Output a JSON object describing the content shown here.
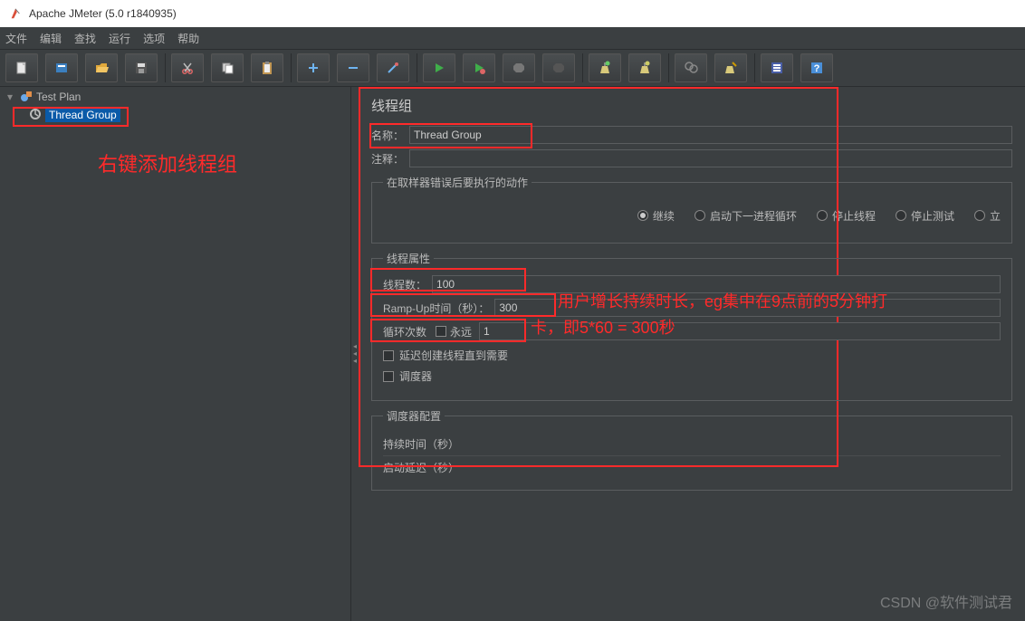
{
  "window": {
    "title": "Apache JMeter (5.0 r1840935)"
  },
  "menu": {
    "file": "文件",
    "edit": "编辑",
    "search": "查找",
    "run": "运行",
    "options": "选项",
    "help": "帮助"
  },
  "toolbar_icons": [
    "new-file-icon",
    "open-templates-icon",
    "open-icon",
    "save-icon",
    "sep",
    "cut-icon",
    "copy-icon",
    "paste-icon",
    "sep",
    "expand-icon",
    "collapse-icon",
    "toggle-icon",
    "sep",
    "start-icon",
    "start-no-timers-icon",
    "stop-icon",
    "shutdown-icon",
    "sep",
    "clear-icon",
    "clear-all-icon",
    "sep",
    "search-icon",
    "reset-search-icon",
    "sep",
    "function-helper-icon",
    "help-icon"
  ],
  "tree": {
    "testplan": "Test Plan",
    "threadgroup": "Thread Group"
  },
  "annotations": {
    "tree_note": "右键添加线程组",
    "rampup_note_line1": "用户增长持续时长，eg集中在9点前的5分钟打",
    "rampup_note_line2": "卡，即5*60 = 300秒"
  },
  "panel": {
    "title": "线程组",
    "name_label": "名称：",
    "name_value": "Thread Group",
    "comment_label": "注释：",
    "comment_value": "",
    "error_action_legend": "在取样器错误后要执行的动作",
    "actions": {
      "continue": "继续",
      "start_next": "启动下一进程循环",
      "stop_thread": "停止线程",
      "stop_test": "停止测试",
      "stop_test_now": "立"
    },
    "thread_props_legend": "线程属性",
    "threads_label": "线程数：",
    "threads_value": "100",
    "rampup_label": "Ramp-Up时间（秒）：",
    "rampup_value": "300",
    "loop_label": "循环次数",
    "forever_label": "永远",
    "loop_value": "1",
    "delay_create_label": "延迟创建线程直到需要",
    "scheduler_label": "调度器",
    "scheduler_conf_legend": "调度器配置",
    "duration_label": "持续时间（秒）",
    "delay_label": "启动延迟（秒）"
  },
  "watermark": "CSDN @软件测试君"
}
